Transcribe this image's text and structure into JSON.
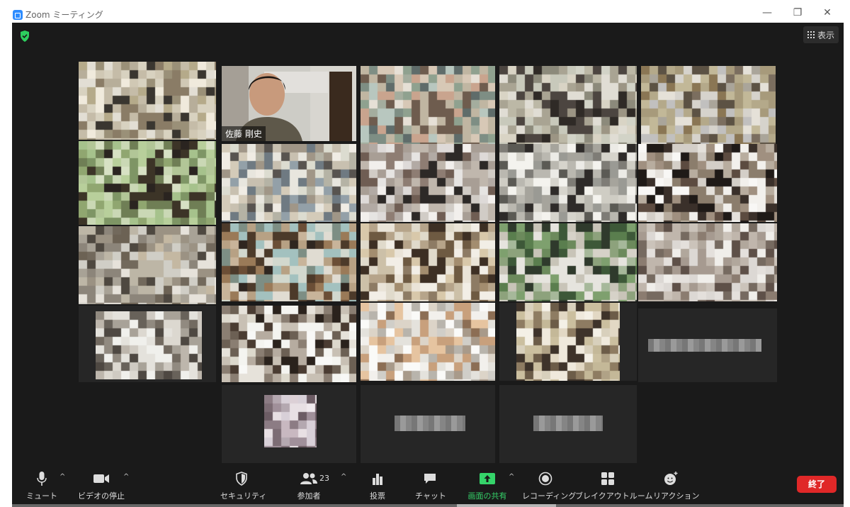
{
  "window": {
    "title": "Zoom ミーティング",
    "min": "—",
    "restore": "❐",
    "close": "✕"
  },
  "header": {
    "view_label": "表示"
  },
  "participants": {
    "featured_name": "佐藤 剛史",
    "tiles": [
      {
        "colors": [
          "#d8d2c0",
          "#c5bca8",
          "#b7ae9a",
          "#8a7c66",
          "#3a3630",
          "#e2ded4",
          "#f0eadc",
          "#b5aa8a",
          "#9a9078",
          "#d0c8b4"
        ]
      },
      {
        "colors": [
          "#d9d2c0",
          "#5a5248",
          "#3b342c",
          "#c7b59b",
          "#8d7f6d",
          "#f3eee2",
          "#2d2621",
          "#8b7561",
          "#4b3f34",
          "#e6dccb"
        ]
      },
      {
        "colors": [
          "#b8c7bf",
          "#8fa18f",
          "#d7c8b6",
          "#6e5c4e",
          "#c0b6a2",
          "#a4ad9e",
          "#e6e0d6",
          "#7e8e84",
          "#5f6c6a",
          "#c9a48e"
        ]
      },
      {
        "colors": [
          "#d2d3c7",
          "#c8c9bb",
          "#8c8a7b",
          "#4c4540",
          "#2f2a26",
          "#e0ddd4",
          "#bcb8a6",
          "#9c9584",
          "#d9d4c5",
          "#a9a493"
        ]
      },
      {
        "colors": [
          "#c2b898",
          "#8a7654",
          "#a79a7b",
          "#c1c0bf",
          "#d6d3cc",
          "#5c5244",
          "#aaa59a",
          "#e5e1d8",
          "#7b6e5f",
          "#b4a98a"
        ]
      },
      {
        "colors": [
          "#a6c28c",
          "#b8cf9b",
          "#7e9565",
          "#3c3427",
          "#2a2420",
          "#cad8b5",
          "#90a670",
          "#d7e1c4",
          "#6f7e55",
          "#b2c697"
        ]
      },
      {
        "colors": [
          "#dcdcd0",
          "#c8c0b0",
          "#f0ece4",
          "#93a0a8",
          "#6f7a82",
          "#b5b3a5",
          "#e8e6de",
          "#585450",
          "#a09687",
          "#d4cbb9"
        ]
      },
      {
        "colors": [
          "#dedad8",
          "#b2aaa4",
          "#6f5d53",
          "#2d2927",
          "#c0b7ad",
          "#e6e4e2",
          "#8e7d73",
          "#f2efec",
          "#a89e95",
          "#d1ccc6"
        ]
      },
      {
        "colors": [
          "#d6d4cc",
          "#9a9a94",
          "#5b5a54",
          "#2e2b29",
          "#bab8b0",
          "#ecebe6",
          "#7e7c76",
          "#f4f3ee",
          "#a6a49c",
          "#cfcdc4"
        ]
      },
      {
        "colors": [
          "#f2f0ec",
          "#d4cfc8",
          "#3a302a",
          "#1f1a17",
          "#8b7d6c",
          "#f8f7f5",
          "#a09080",
          "#e4e0da",
          "#5c4b40",
          "#b8ad9f"
        ]
      },
      {
        "colors": [
          "#a8a296",
          "#8c857a",
          "#6c6254",
          "#d0cec6",
          "#bdb6a6",
          "#4e4840",
          "#c4b8a2",
          "#e6e2da",
          "#9b9283",
          "#72695c"
        ]
      },
      {
        "colors": [
          "#6b4e36",
          "#9a7a58",
          "#4c3a2a",
          "#d2d8ce",
          "#a3c1bf",
          "#2f2620",
          "#c8b49a",
          "#7d8e84",
          "#e0dcd2",
          "#b7a184"
        ]
      },
      {
        "colors": [
          "#e0dacb",
          "#d8c8aa",
          "#6e5a42",
          "#3d2f24",
          "#f2eee6",
          "#b6a48a",
          "#8d7b64",
          "#ccc0a8",
          "#eae4d8",
          "#a38d6f"
        ]
      },
      {
        "colors": [
          "#7ea06e",
          "#5a7e4e",
          "#3d5838",
          "#c8c4b8",
          "#e6e4de",
          "#a6b89a",
          "#2f3a2c",
          "#8da27c",
          "#d6d2c8",
          "#6c8a5c"
        ]
      },
      {
        "colors": [
          "#dcd8d4",
          "#c0b6ac",
          "#8b7c70",
          "#f0eeea",
          "#a69a90",
          "#5e5048",
          "#e4e0dc",
          "#cbc3ba",
          "#b1a79c",
          "#766a60"
        ]
      },
      {
        "colors": [
          "#cfcac2",
          "#a8a298",
          "#726a60",
          "#e4e2dc",
          "#f0f0ec",
          "#4e4842",
          "#bdb6ac",
          "#918a80",
          "#dcd8d0",
          "#68625a"
        ]
      },
      {
        "colors": [
          "#f4f4f0",
          "#dcd8cc",
          "#4a3c32",
          "#2a221c",
          "#b6aca0",
          "#e6e2da",
          "#8a7e72",
          "#f8f8f6",
          "#c8c0b4",
          "#6c6054"
        ]
      },
      {
        "colors": [
          "#e4e2dc",
          "#d0cec8",
          "#f2f0ec",
          "#c8a07c",
          "#e6c4a0",
          "#8c6e54",
          "#b8b4ac",
          "#fafaf8",
          "#a89a8a",
          "#dcd4c8"
        ]
      },
      {
        "colors": [
          "#d8d0bc",
          "#c4b898",
          "#6c5c48",
          "#3e332a",
          "#efe9dc",
          "#b0a286",
          "#e2d8c4",
          "#8e7c62",
          "#cbbf9f",
          "#f4f0e6"
        ]
      },
      {
        "colors": [
          "#d8d0d8",
          "#b4a8b0",
          "#8c7c84",
          "#e8e0e4",
          "#c8b8c0",
          "#6c5c64",
          "#f0eaee",
          "#a0909a",
          "#dcd0d6",
          "#7c6c74"
        ]
      }
    ],
    "blurred_names": [
      "",
      "",
      ""
    ]
  },
  "toolbar": {
    "mute": "ミュート",
    "video": "ビデオの停止",
    "security": "セキュリティ",
    "participants": "参加者",
    "participants_count": "23",
    "poll": "投票",
    "chat": "チャット",
    "share": "画面の共有",
    "record": "レコーディング",
    "breakout": "ブレイクアウトルーム",
    "reaction": "リアクション",
    "end": "終了",
    "caret": "^"
  },
  "colors": {
    "accent_green": "#35d46a",
    "end_red": "#e02828",
    "zoom_blue": "#2d8cff"
  }
}
